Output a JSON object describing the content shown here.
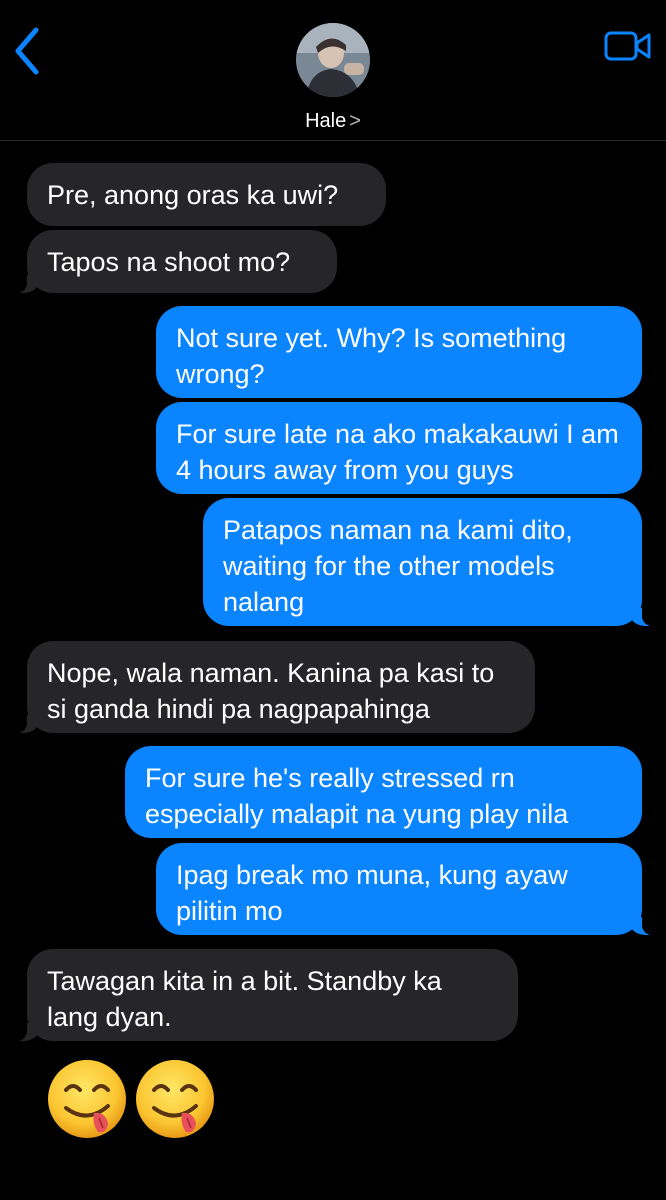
{
  "header": {
    "contact_name": "Hale",
    "chevron": ">",
    "back_icon": "chevron-left-icon",
    "video_icon": "video-camera-icon",
    "accent_color": "#0a84ff"
  },
  "messages": [
    {
      "direction": "incoming",
      "text": "Pre, anong oras ka uwi?"
    },
    {
      "direction": "incoming",
      "text": "Tapos na shoot mo?"
    },
    {
      "direction": "outgoing",
      "text": "Not sure yet. Why? Is something wrong?"
    },
    {
      "direction": "outgoing",
      "text": "For sure late na ako makakauwi I am 4 hours away from you guys"
    },
    {
      "direction": "outgoing",
      "text": "Patapos naman na kami dito, waiting for the other models nalang"
    },
    {
      "direction": "incoming",
      "text": "Nope, wala naman. Kanina pa kasi to si ganda hindi pa nagpapahinga"
    },
    {
      "direction": "outgoing",
      "text": "For sure he's really stressed rn especially malapit na yung play nila"
    },
    {
      "direction": "outgoing",
      "text": "Ipag break mo muna, kung ayaw pilitin mo"
    },
    {
      "direction": "incoming",
      "text": "Tawagan kita in a bit. Standby ka lang dyan."
    }
  ],
  "emoji_message": {
    "direction": "incoming",
    "emojis": [
      "face-savoring-food-emoji",
      "face-savoring-food-emoji"
    ]
  },
  "colors": {
    "incoming_bubble": "#262628",
    "outgoing_bubble": "#0a84ff",
    "background": "#000000"
  }
}
